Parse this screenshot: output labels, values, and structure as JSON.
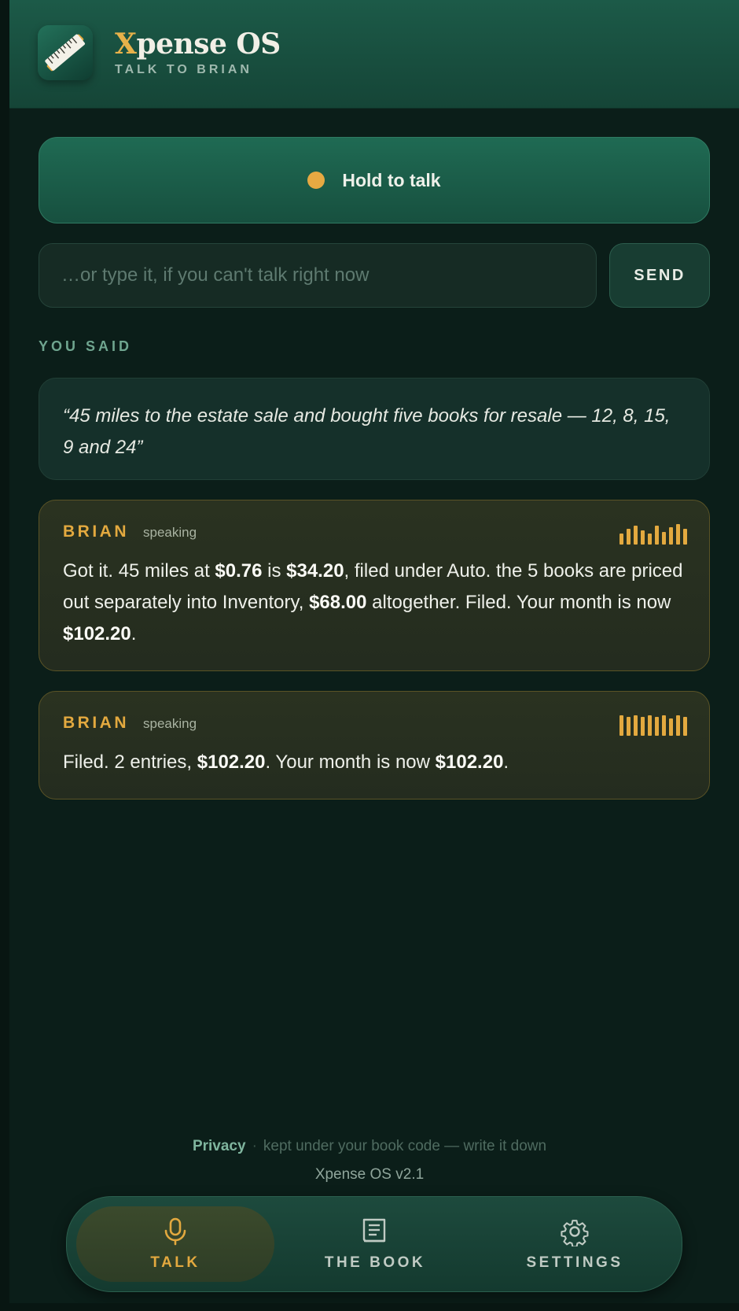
{
  "app": {
    "name_accent": "X",
    "name_rest": "pense OS",
    "subtitle": "TALK TO BRIAN",
    "logo_icon": "ruler-pencil-icon"
  },
  "talk": {
    "hold_label": "Hold to talk",
    "input_placeholder": "…or type it, if you can't talk right now",
    "input_value": "",
    "send_label": "SEND"
  },
  "transcript": {
    "section_label": "YOU SAID",
    "you_said": "“45 miles to the estate sale and bought five books for resale — 12, 8, 15, 9 and 24”"
  },
  "brian_messages": [
    {
      "name": "BRIAN",
      "status": "speaking",
      "parts": {
        "p1": "Got it. 45 miles at ",
        "b1": "$0.76",
        "p2": " is ",
        "b2": "$34.20",
        "p3": ", filed under Auto. the 5 books are priced out separately into Inventory, ",
        "b3": "$68.00",
        "p4": " altogether. Filed. Your month is now ",
        "b4": "$102.20",
        "p5": "."
      }
    },
    {
      "name": "BRIAN",
      "status": "speaking",
      "parts": {
        "p1": "Filed. 2 entries, ",
        "b1": "$102.20",
        "p2": ". Your month is now ",
        "b2": "$102.20",
        "p3": "."
      }
    }
  ],
  "footer": {
    "privacy_label": "Privacy",
    "separator": "·",
    "privacy_note": "kept under your book code — write it down",
    "version": "Xpense OS v2.1"
  },
  "nav": {
    "items": [
      {
        "label": "TALK",
        "icon": "microphone-icon",
        "active": true
      },
      {
        "label": "THE BOOK",
        "icon": "book-icon",
        "active": false
      },
      {
        "label": "SETTINGS",
        "icon": "gear-icon",
        "active": false
      }
    ]
  },
  "colors": {
    "accent_gold": "#e3a93f",
    "header_green": "#1c5a48",
    "background": "#0b1e19"
  }
}
